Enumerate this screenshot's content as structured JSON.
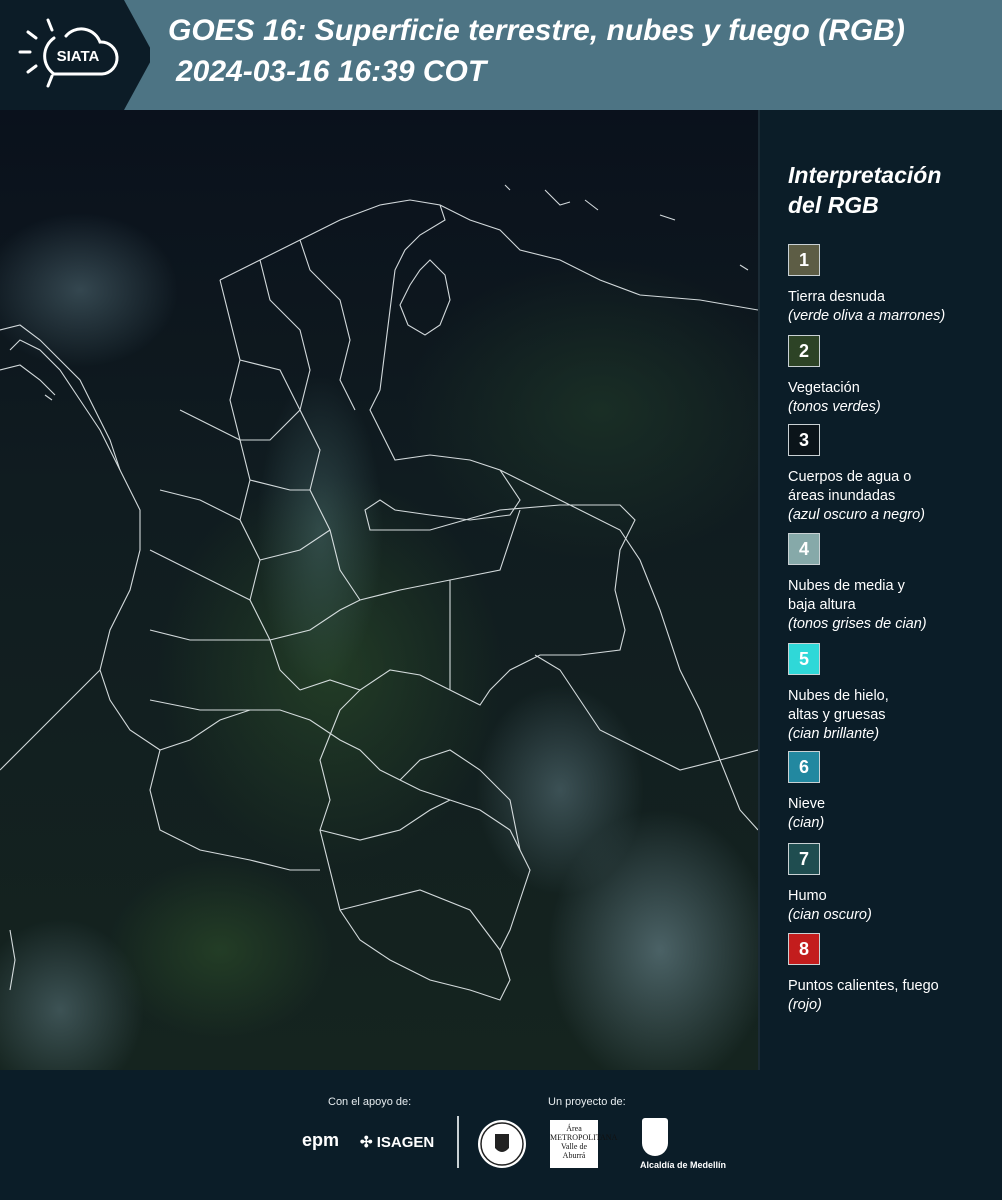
{
  "header": {
    "logo_text": "SIATA",
    "title_line1": "GOES 16: Superficie terrestre, nubes y fuego (RGB)",
    "title_line2": "2024-03-16 16:39 COT"
  },
  "legend": {
    "title": "Interpretación\ndel RGB",
    "items": [
      {
        "number": "1",
        "label": "Tierra desnuda",
        "hint": "(verde oliva a marrones)",
        "color": "#5d5d45"
      },
      {
        "number": "2",
        "label": "Vegetación",
        "hint": "(tonos verdes)",
        "color": "#2d4326"
      },
      {
        "number": "3",
        "label": "Cuerpos de agua o\náreas inundadas",
        "hint": "(azul oscuro a negro)",
        "color": "#0b141a"
      },
      {
        "number": "4",
        "label": "Nubes de media y\nbaja altura",
        "hint": "(tonos grises de cian)",
        "color": "#86a9a9"
      },
      {
        "number": "5",
        "label": "Nubes de hielo,\naltas y gruesas",
        "hint": "(cian brillante)",
        "color": "#2fd8d8"
      },
      {
        "number": "6",
        "label": "Nieve",
        "hint": "(cian)",
        "color": "#2288a0"
      },
      {
        "number": "7",
        "label": "Humo",
        "hint": "(cian oscuro)",
        "color": "#1f4d50"
      },
      {
        "number": "8",
        "label": "Puntos calientes, fuego",
        "hint": "(rojo)",
        "color": "#c31d1d"
      }
    ]
  },
  "footer": {
    "support_label": "Con el apoyo de:",
    "project_label": "Un proyecto de:",
    "sponsor_epm": "epm",
    "sponsor_isagen": "ISAGEN",
    "area_metropolitana": "Área\nMETROPOLITANA\nValle de Aburrá",
    "alcaldia": "Alcaldía de Medellín"
  }
}
